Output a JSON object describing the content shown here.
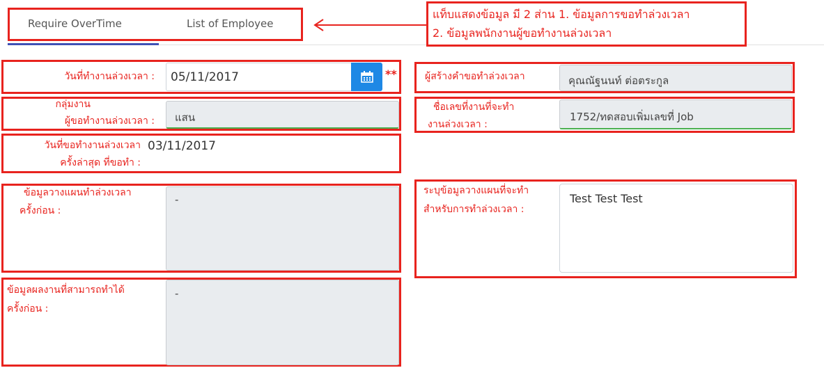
{
  "tabs": [
    {
      "label": "Require OverTime",
      "active": true
    },
    {
      "label": "List of Employee",
      "active": false
    }
  ],
  "callout": {
    "line1": "แท็บแสดงข้อมูล มี 2 ส่าน 1. ข้อมูลการขอทำล่วงเวลา",
    "line2": "2. ข้อมูลพนักงานผู้ขอทำงานล่วงเวลา"
  },
  "left": {
    "work_date_label": "วันที่ทำงานล่วงเวลา :",
    "work_date_value": "05/11/2017",
    "required_mark": "**",
    "group_label_1": "กลุ่มงาน",
    "group_label_2": "ผู้ขอทำงานล่วงเวลา :",
    "group_value": "แสน",
    "last_date_label_1": "วันที่ขอทำงานล่วงเวลา",
    "last_date_label_2": "ครั้งล่าสุด ที่ขอทำ :",
    "last_date_value": "03/11/2017",
    "prev_plan_label_1": "ข้อมูลวางแผนทำล่วงเวลา",
    "prev_plan_label_2": "ครั้งก่อน :",
    "prev_plan_value": "-",
    "prev_result_label_1": "ข้อมูลผลงานที่สามารถทำได้",
    "prev_result_label_2": "ครั้งก่อน :",
    "prev_result_value": "-"
  },
  "right": {
    "creator_label": "ผู้สร้างคำขอทำล่วงเวลา",
    "creator_value": "คุณณัฐนนท์  ต่อตระกูล",
    "job_label_1": "ชื่อเลขที่งานที่จะทำ",
    "job_label_2": "งานล่วงเวลา :",
    "job_value": "1752/ทดสอบเพิ่มเลขที่ Job",
    "plan_label_1": "ระบุข้อมูลวางแผนที่จะทำ",
    "plan_label_2": "สำหรับการทำล่วงเวลา :",
    "plan_value": "Test Test Test"
  },
  "colors": {
    "annotation_red": "#e8231e",
    "tab_underline": "#3f51b5",
    "calendar_button": "#1e88e5",
    "valid_green": "#4caf50"
  },
  "icons": [
    "calendar-icon",
    "arrow-left-icon"
  ]
}
